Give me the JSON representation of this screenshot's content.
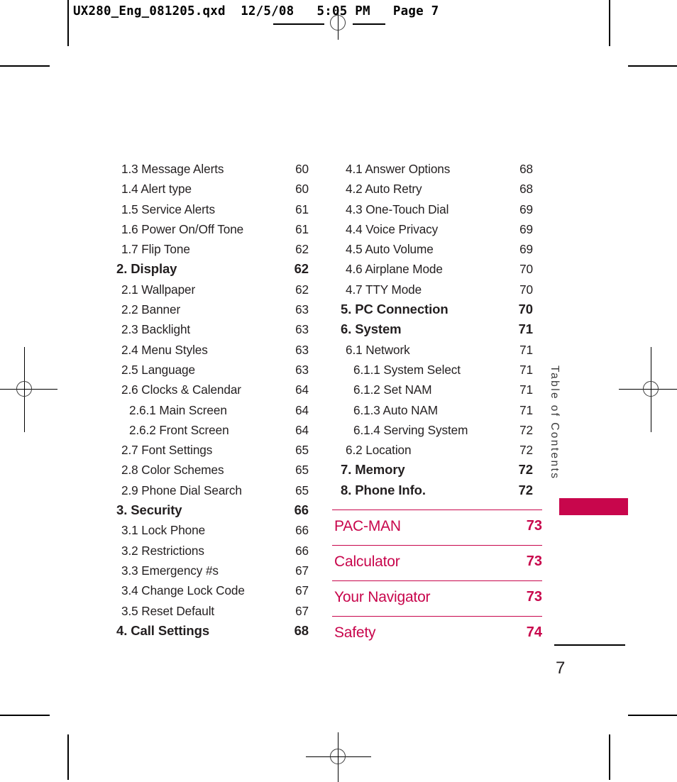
{
  "print_header": "UX280_Eng_081205.qxd  12/5/08   5:05 PM   Page 7",
  "side_label": "Table of Contents",
  "page_number": "7",
  "accent_color": "#c8064c",
  "toc": {
    "left_column": [
      {
        "level": 2,
        "label": "1.3 Message Alerts",
        "page": "60"
      },
      {
        "level": 2,
        "label": "1.4 Alert type",
        "page": "60"
      },
      {
        "level": 2,
        "label": "1.5 Service Alerts",
        "page": "61"
      },
      {
        "level": 2,
        "label": "1.6 Power On/Off Tone",
        "page": "61"
      },
      {
        "level": 2,
        "label": "1.7 Flip Tone",
        "page": "62"
      },
      {
        "level": 1,
        "label": "2. Display",
        "page": "62"
      },
      {
        "level": 2,
        "label": "2.1 Wallpaper",
        "page": "62"
      },
      {
        "level": 2,
        "label": "2.2 Banner",
        "page": "63"
      },
      {
        "level": 2,
        "label": "2.3 Backlight",
        "page": "63"
      },
      {
        "level": 2,
        "label": "2.4 Menu Styles",
        "page": "63"
      },
      {
        "level": 2,
        "label": "2.5 Language",
        "page": "63"
      },
      {
        "level": 2,
        "label": "2.6 Clocks & Calendar",
        "page": "64"
      },
      {
        "level": 3,
        "label": "2.6.1 Main Screen",
        "page": "64"
      },
      {
        "level": 3,
        "label": "2.6.2 Front Screen",
        "page": "64"
      },
      {
        "level": 2,
        "label": "2.7 Font Settings",
        "page": "65"
      },
      {
        "level": 2,
        "label": "2.8 Color Schemes",
        "page": "65"
      },
      {
        "level": 2,
        "label": "2.9 Phone Dial Search",
        "page": "65"
      },
      {
        "level": 1,
        "label": "3. Security",
        "page": "66"
      },
      {
        "level": 2,
        "label": "3.1 Lock Phone",
        "page": "66"
      },
      {
        "level": 2,
        "label": "3.2 Restrictions",
        "page": "66"
      },
      {
        "level": 2,
        "label": "3.3 Emergency #s",
        "page": "67"
      },
      {
        "level": 2,
        "label": "3.4 Change Lock Code",
        "page": "67"
      },
      {
        "level": 2,
        "label": "3.5 Reset Default",
        "page": "67"
      },
      {
        "level": 1,
        "label": "4. Call Settings",
        "page": "68"
      }
    ],
    "right_column": [
      {
        "level": 2,
        "label": "4.1 Answer Options",
        "page": "68"
      },
      {
        "level": 2,
        "label": "4.2 Auto Retry",
        "page": "68"
      },
      {
        "level": 2,
        "label": "4.3 One-Touch Dial",
        "page": "69"
      },
      {
        "level": 2,
        "label": "4.4 Voice Privacy",
        "page": "69"
      },
      {
        "level": 2,
        "label": "4.5 Auto Volume",
        "page": "69"
      },
      {
        "level": 2,
        "label": "4.6 Airplane Mode",
        "page": "70"
      },
      {
        "level": 2,
        "label": "4.7 TTY Mode",
        "page": "70"
      },
      {
        "level": 1,
        "label": "5. PC Connection",
        "page": "70"
      },
      {
        "level": 1,
        "label": "6. System",
        "page": "71"
      },
      {
        "level": 2,
        "label": "6.1 Network",
        "page": "71"
      },
      {
        "level": 3,
        "label": "6.1.1 System Select",
        "page": "71"
      },
      {
        "level": 3,
        "label": "6.1.2 Set NAM",
        "page": "71"
      },
      {
        "level": 3,
        "label": "6.1.3 Auto NAM",
        "page": "71"
      },
      {
        "level": 3,
        "label": "6.1.4 Serving System",
        "page": "72"
      },
      {
        "level": 2,
        "label": "6.2 Location",
        "page": "72"
      },
      {
        "level": 1,
        "label": "7. Memory",
        "page": "72"
      },
      {
        "level": 1,
        "label": "8. Phone Info.",
        "page": "72"
      }
    ],
    "chapters": [
      {
        "label": "PAC-MAN",
        "page": "73"
      },
      {
        "label": "Calculator",
        "page": "73"
      },
      {
        "label": "Your Navigator",
        "page": "73"
      },
      {
        "label": "Safety",
        "page": "74"
      }
    ]
  }
}
